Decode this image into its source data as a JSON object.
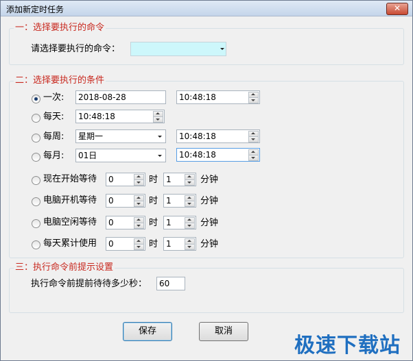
{
  "window": {
    "title": "添加新定时任务",
    "close_glyph": "✕"
  },
  "section1": {
    "title": "一：选择要执行的命令",
    "prompt": "请选择要执行的命令：",
    "command_value": ""
  },
  "section2": {
    "title": "二：选择要执行的条件",
    "once": {
      "label": "一次:",
      "date": "2018-08-28",
      "time": "10:48:18",
      "checked": true
    },
    "daily": {
      "label": "每天:",
      "time": "10:48:18"
    },
    "weekly": {
      "label": "每周:",
      "day": "星期一",
      "time": "10:48:18"
    },
    "monthly": {
      "label": "每月:",
      "day": "01日",
      "time": "10:48:18"
    },
    "waits": [
      {
        "label": "现在开始等待",
        "hours": "0",
        "hours_unit": "时",
        "minutes": "1",
        "minutes_unit": "分钟"
      },
      {
        "label": "电脑开机等待",
        "hours": "0",
        "hours_unit": "时",
        "minutes": "1",
        "minutes_unit": "分钟"
      },
      {
        "label": "电脑空闲等待",
        "hours": "0",
        "hours_unit": "时",
        "minutes": "1",
        "minutes_unit": "分钟"
      },
      {
        "label": "每天累计使用",
        "hours": "0",
        "hours_unit": "时",
        "minutes": "1",
        "minutes_unit": "分钟"
      }
    ]
  },
  "section3": {
    "title": "三：执行命令前提示设置",
    "prompt": "执行命令前提前待待多少秒：",
    "seconds": "60"
  },
  "buttons": {
    "save": "保存",
    "cancel": "取消"
  },
  "watermark": "极速下载站"
}
